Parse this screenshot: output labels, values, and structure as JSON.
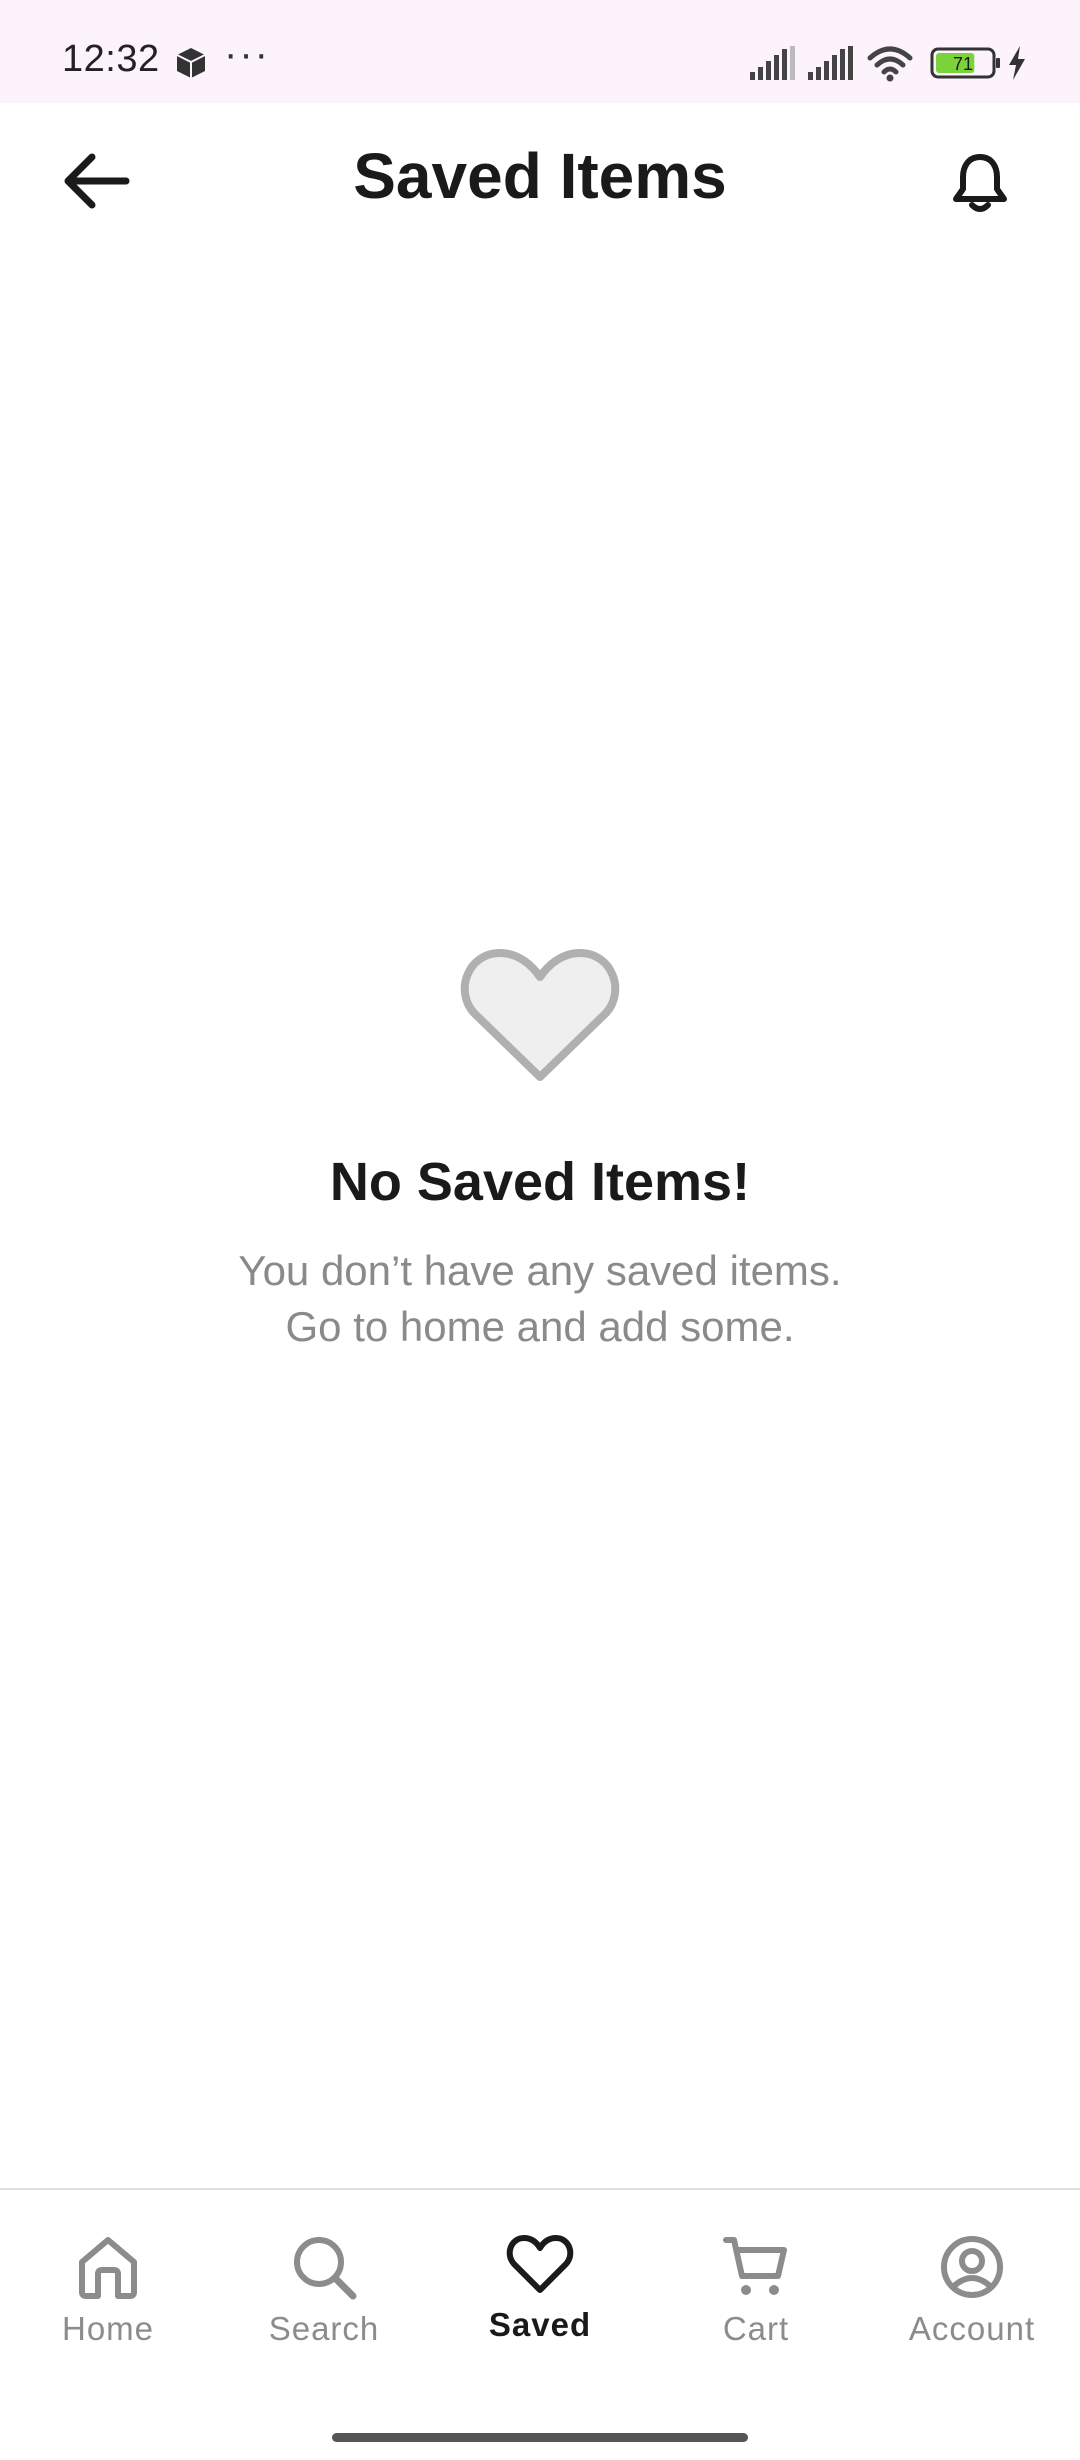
{
  "status_bar": {
    "time": "12:32",
    "more": "···",
    "battery_level": "71",
    "battery_fill_percent": 71
  },
  "header": {
    "title": "Saved Items"
  },
  "empty_state": {
    "title": "No Saved Items!",
    "line1": "You don’t have any saved items.",
    "line2": "Go to home and add some."
  },
  "bottom_nav": {
    "items": [
      {
        "label": "Home",
        "icon": "home-icon",
        "active": false
      },
      {
        "label": "Search",
        "icon": "search-icon",
        "active": false
      },
      {
        "label": "Saved",
        "icon": "heart-icon",
        "active": true
      },
      {
        "label": "Cart",
        "icon": "cart-icon",
        "active": false
      },
      {
        "label": "Account",
        "icon": "account-icon",
        "active": false
      }
    ]
  },
  "colors": {
    "status_bar_bg": "#fcf3fc",
    "text_primary": "#1a1a1a",
    "text_muted": "#8a8a8a",
    "heart_fill": "#efefef",
    "heart_stroke": "#b0b0b0",
    "battery_fill": "#7bd33a"
  }
}
